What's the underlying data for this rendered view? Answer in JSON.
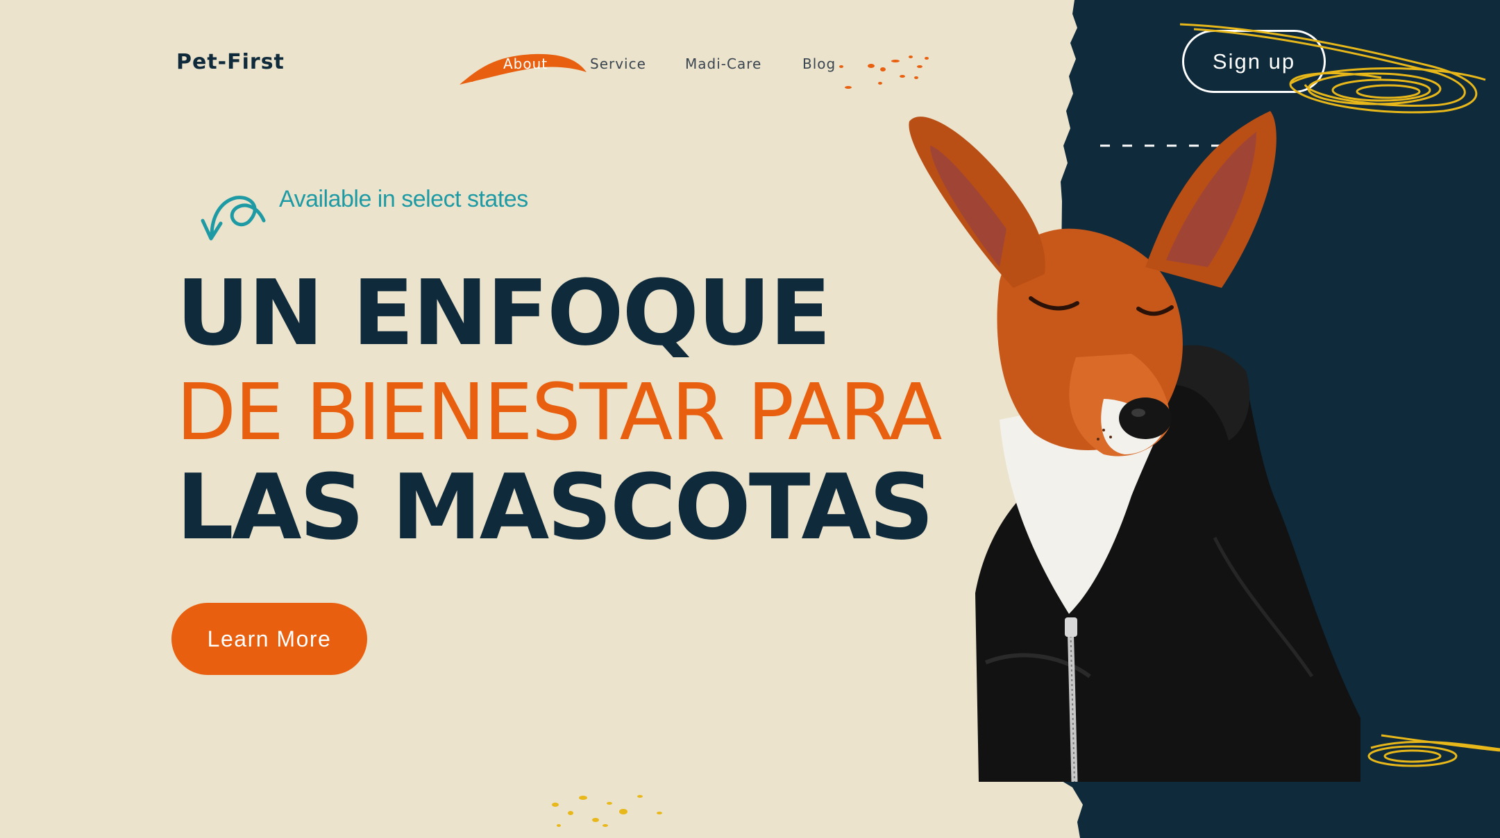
{
  "brand": {
    "logo_text": "Pet-First"
  },
  "nav": {
    "items": [
      {
        "label": "About",
        "active": true
      },
      {
        "label": "Service",
        "active": false
      },
      {
        "label": "Madi-Care",
        "active": false
      },
      {
        "label": "Blog",
        "active": false
      }
    ]
  },
  "header": {
    "signup_label": "Sign up"
  },
  "hero": {
    "badge": "Available in select states",
    "line1": "UN ENFOQUE",
    "line2": "DE BIENESTAR PARA",
    "line3": "LAS MASCOTAS",
    "cta_label": "Learn More"
  },
  "colors": {
    "background": "#ebe3cc",
    "dark_panel": "#0f2a3b",
    "accent_orange": "#e8600f",
    "teal": "#1d9aa4",
    "yellow_scribble": "#e8b81a"
  },
  "icons": {
    "badge_arrow": "curly-arrow-icon",
    "nav_highlight": "brush-stroke",
    "decor": "yellow-scribble"
  }
}
